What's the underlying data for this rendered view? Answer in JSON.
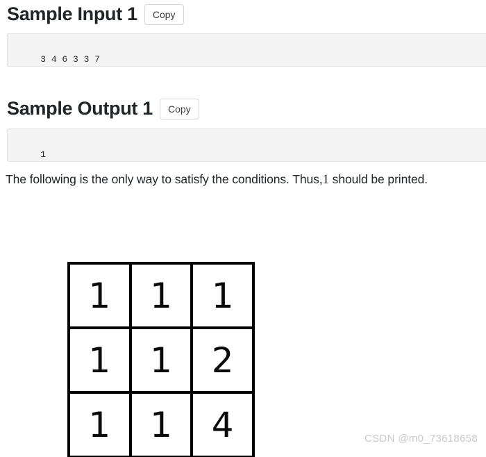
{
  "page": {
    "background_color": "#ffffff",
    "watermark": "CSDN @m0_73618658"
  },
  "sample_input": {
    "heading": "Sample Input 1",
    "copy_label": "Copy",
    "content": "3 4 6 3 3 7"
  },
  "sample_output": {
    "heading": "Sample Output 1",
    "copy_label": "Copy",
    "content": "1"
  },
  "explanation": {
    "text_before": "The following is the only way to satisfy the conditions. Thus,",
    "highlight_number": "1",
    "text_after": "should be printed."
  },
  "grid_figure": {
    "rows": 3,
    "columns": 3,
    "cells": [
      [
        "1",
        "1",
        "1"
      ],
      [
        "1",
        "1",
        "2"
      ],
      [
        "1",
        "1",
        "4"
      ]
    ],
    "border_color": "#000000",
    "cell_background": "#ffffff"
  },
  "colors": {
    "heading_text": "#212529",
    "code_background": "#f4f4f4",
    "code_border": "#e3e3e3",
    "button_border": "#d6d6d6",
    "watermark_text": "#c9c9c9"
  }
}
